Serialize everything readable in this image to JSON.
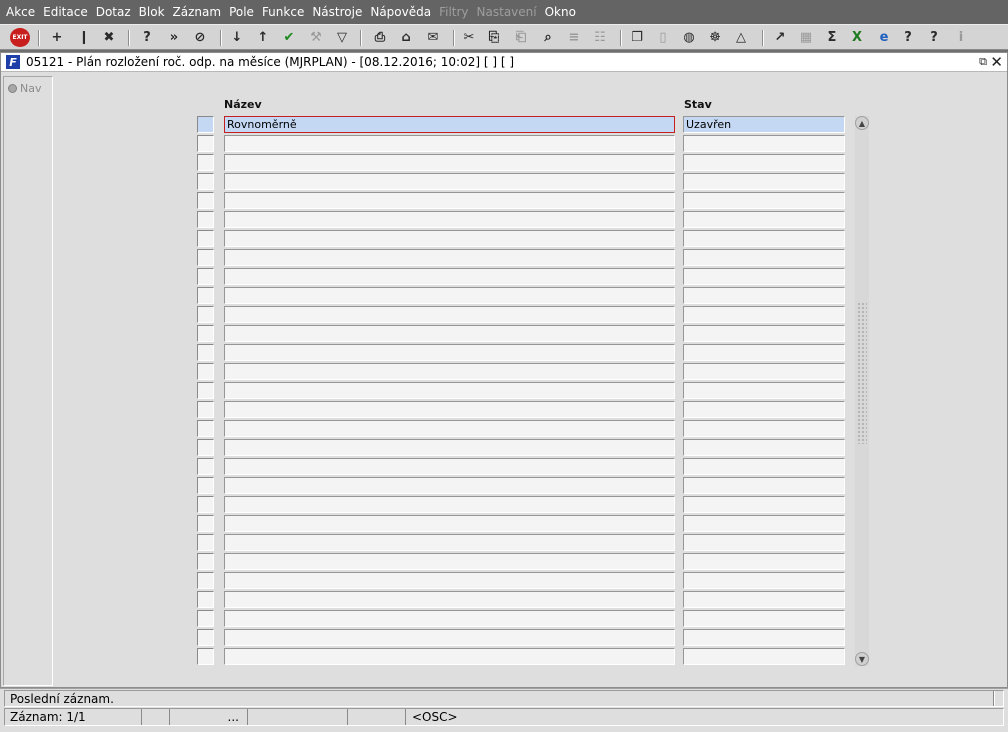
{
  "menu": [
    "Akce",
    "Editace",
    "Dotaz",
    "Blok",
    "Záznam",
    "Pole",
    "Funkce",
    "Nástroje",
    "Nápověda",
    "Filtry",
    "Nastavení",
    "Okno"
  ],
  "menu_disabled": [
    "Filtry",
    "Nastavení"
  ],
  "toolbar": {
    "exit_label": "EXIT",
    "icons": [
      "exit-icon",
      "insert-record-icon",
      "duplicate-record-icon",
      "delete-record-icon",
      "enter-query-icon",
      "execute-query-icon",
      "cancel-query-icon",
      "sort-ascending-icon",
      "sort-descending-icon",
      "commit-icon",
      "tools-icon",
      "filter-icon",
      "print-icon",
      "attachment-icon",
      "mail-icon",
      "cut-icon",
      "copy-icon",
      "paste-icon",
      "find-icon",
      "list-icon",
      "tree-icon",
      "clipboard-icon",
      "document-icon",
      "globe-icon",
      "settings-icon",
      "warning-icon",
      "chart-icon",
      "calculator-icon",
      "sum-icon",
      "excel-icon",
      "browser-icon",
      "help-icon",
      "whats-this-icon",
      "info-icon"
    ]
  },
  "window": {
    "title": "05121 - Plán rozložení roč. odp. na měsíce (MJRPLAN) - [08.12.2016; 10:02]  [ ]  [ ]",
    "logo_letter": "F"
  },
  "nav": {
    "label": "Nav"
  },
  "table": {
    "headers": {
      "name": "Název",
      "status": "Stav"
    },
    "rows": [
      {
        "name": "Rovnoměrně",
        "status": "Uzavřen"
      },
      {
        "name": "",
        "status": ""
      },
      {
        "name": "",
        "status": ""
      },
      {
        "name": "",
        "status": ""
      },
      {
        "name": "",
        "status": ""
      },
      {
        "name": "",
        "status": ""
      },
      {
        "name": "",
        "status": ""
      },
      {
        "name": "",
        "status": ""
      },
      {
        "name": "",
        "status": ""
      },
      {
        "name": "",
        "status": ""
      },
      {
        "name": "",
        "status": ""
      },
      {
        "name": "",
        "status": ""
      },
      {
        "name": "",
        "status": ""
      },
      {
        "name": "",
        "status": ""
      },
      {
        "name": "",
        "status": ""
      },
      {
        "name": "",
        "status": ""
      },
      {
        "name": "",
        "status": ""
      },
      {
        "name": "",
        "status": ""
      },
      {
        "name": "",
        "status": ""
      },
      {
        "name": "",
        "status": ""
      },
      {
        "name": "",
        "status": ""
      },
      {
        "name": "",
        "status": ""
      },
      {
        "name": "",
        "status": ""
      },
      {
        "name": "",
        "status": ""
      },
      {
        "name": "",
        "status": ""
      },
      {
        "name": "",
        "status": ""
      },
      {
        "name": "",
        "status": ""
      },
      {
        "name": "",
        "status": ""
      },
      {
        "name": "",
        "status": ""
      }
    ]
  },
  "status": {
    "message": "Poslední záznam.",
    "record": "Záznam: 1/1",
    "ellipsis": "...",
    "mode": "<OSC>"
  },
  "colors": {
    "menubar": "#646464",
    "current_row": "#c4d8f4",
    "focus_border": "#c42020",
    "logo": "#1f3fa8"
  }
}
